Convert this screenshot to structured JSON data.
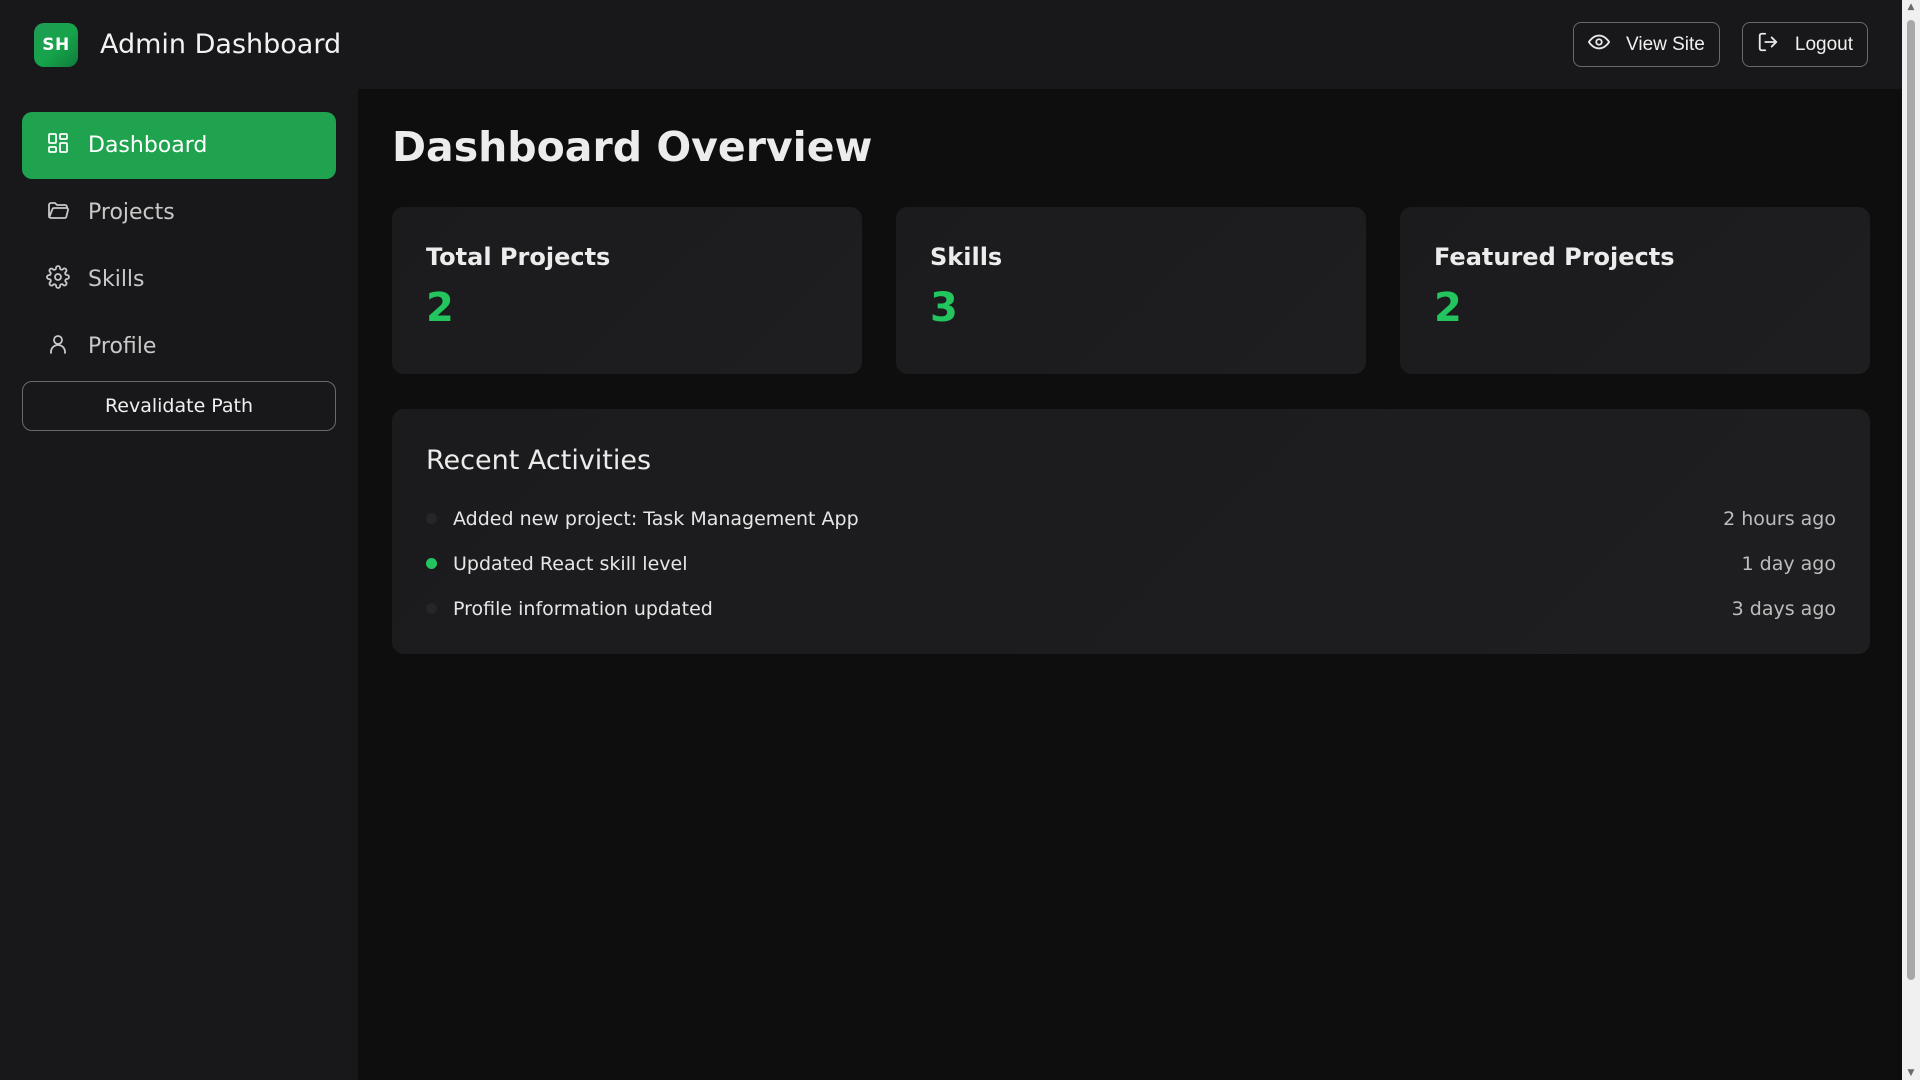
{
  "header": {
    "logo_text": "SH",
    "title": "Admin Dashboard",
    "view_site_label": "View Site",
    "logout_label": "Logout"
  },
  "sidebar": {
    "items": [
      {
        "label": "Dashboard",
        "icon": "grid-icon",
        "active": true
      },
      {
        "label": "Projects",
        "icon": "folder-icon",
        "active": false
      },
      {
        "label": "Skills",
        "icon": "gear-icon",
        "active": false
      },
      {
        "label": "Profile",
        "icon": "user-icon",
        "active": false
      }
    ],
    "revalidate_label": "Revalidate Path"
  },
  "main": {
    "title": "Dashboard Overview",
    "stats": [
      {
        "label": "Total Projects",
        "value": "2"
      },
      {
        "label": "Skills",
        "value": "3"
      },
      {
        "label": "Featured Projects",
        "value": "2"
      }
    ],
    "activities": {
      "title": "Recent Activities",
      "items": [
        {
          "text": "Added new project: Task Management App",
          "time": "2 hours ago",
          "highlight": false
        },
        {
          "text": "Updated React skill level",
          "time": "1 day ago",
          "highlight": true
        },
        {
          "text": "Profile information updated",
          "time": "3 days ago",
          "highlight": false
        }
      ]
    }
  },
  "colors": {
    "accent": "#1fa34f",
    "value": "#22c55e",
    "background": "#0e0e0f",
    "surface": "#18181a"
  }
}
